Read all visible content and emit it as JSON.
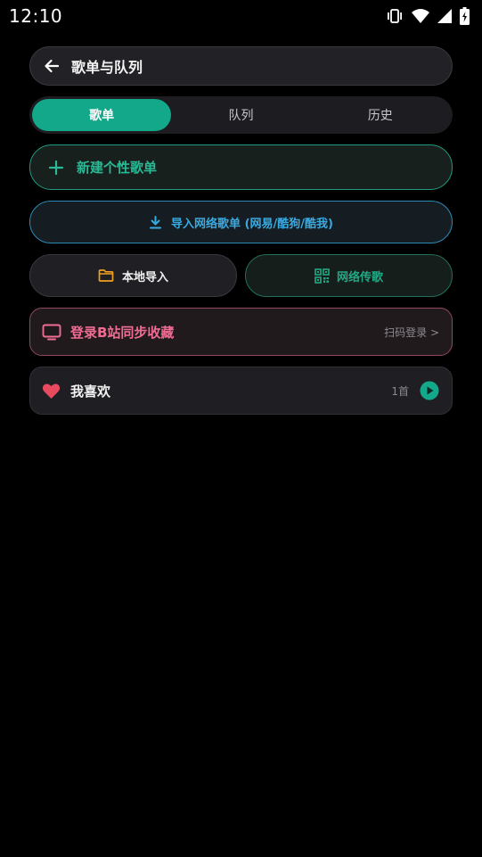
{
  "status_bar": {
    "time": "12:10",
    "icons": [
      "vibrate-icon",
      "wifi-icon",
      "signal-icon",
      "battery-charging-icon"
    ]
  },
  "header": {
    "back_icon": "arrow-left-icon",
    "title": "歌单与队列"
  },
  "tabs": [
    {
      "label": "歌单",
      "active": true
    },
    {
      "label": "队列",
      "active": false
    },
    {
      "label": "历史",
      "active": false
    }
  ],
  "actions": {
    "new_playlist": {
      "icon": "plus-icon",
      "label": "新建个性歌单"
    },
    "import_online": {
      "icon": "download-icon",
      "label": "导入网络歌单 (网易/酷狗/酷我)"
    },
    "local_import": {
      "icon": "folder-icon",
      "label": "本地导入"
    },
    "network_transfer": {
      "icon": "qr-code-icon",
      "label": "网络传歌"
    },
    "bilibili_login": {
      "icon": "tv-icon",
      "label": "登录B站同步收藏",
      "hint": "扫码登录 >"
    }
  },
  "playlists": [
    {
      "icon": "heart-icon",
      "name": "我喜欢",
      "count": "1首",
      "action_icon": "play-icon"
    }
  ],
  "colors": {
    "accent": "#12a889",
    "import_blue": "#39a9e0",
    "bilibili_pink": "#ef6c93",
    "folder_orange": "#f0a020",
    "heart_red": "#e84a5f"
  }
}
